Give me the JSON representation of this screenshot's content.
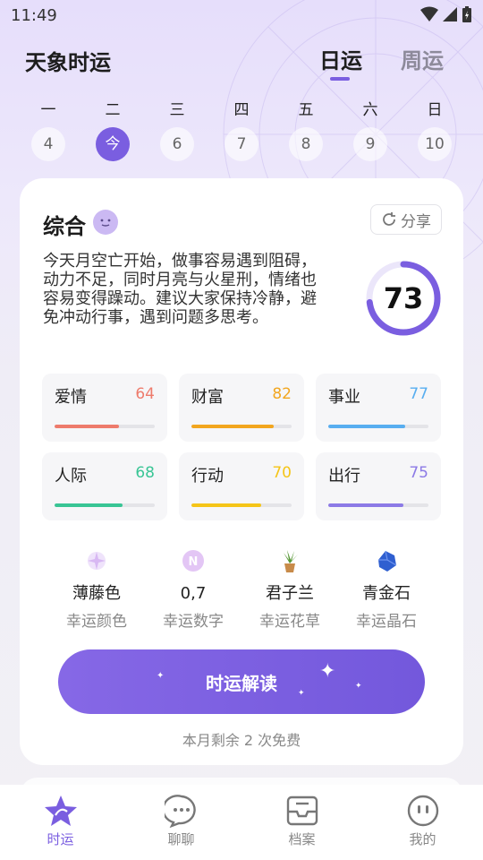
{
  "status": {
    "time": "11:49"
  },
  "header": {
    "title": "天象时运",
    "tabs": [
      {
        "label": "日运",
        "active": true
      },
      {
        "label": "周运",
        "active": false
      }
    ]
  },
  "week": {
    "days": [
      {
        "name": "一",
        "num": "4"
      },
      {
        "name": "二",
        "num": "今",
        "active": true
      },
      {
        "name": "三",
        "num": "6"
      },
      {
        "name": "四",
        "num": "7"
      },
      {
        "name": "五",
        "num": "8"
      },
      {
        "name": "六",
        "num": "9"
      },
      {
        "name": "日",
        "num": "10"
      }
    ]
  },
  "overall": {
    "title": "综合",
    "share_label": "分享",
    "summary": "今天月空亡开始，做事容易遇到阻碍，动力不足，同时月亮与火星刑，情绪也容易变得躁动。建议大家保持冷静，避免冲动行事，遇到问题多思考。",
    "score": "73",
    "score_value": 73
  },
  "metrics": [
    {
      "label": "爱情",
      "value": "64",
      "percent": 64,
      "color": "#ee7b6c"
    },
    {
      "label": "财富",
      "value": "82",
      "percent": 82,
      "color": "#f2a61f"
    },
    {
      "label": "事业",
      "value": "77",
      "percent": 77,
      "color": "#58aef0"
    },
    {
      "label": "人际",
      "value": "68",
      "percent": 68,
      "color": "#39c595"
    },
    {
      "label": "行动",
      "value": "70",
      "percent": 70,
      "color": "#f5c518"
    },
    {
      "label": "出行",
      "value": "75",
      "percent": 75,
      "color": "#8c7ae6"
    }
  ],
  "lucky": [
    {
      "value": "薄藤色",
      "label": "幸运颜色",
      "icon": "sparkle-icon"
    },
    {
      "value": "0,7",
      "label": "幸运数字",
      "icon": "number-badge-icon"
    },
    {
      "value": "君子兰",
      "label": "幸运花草",
      "icon": "plant-icon"
    },
    {
      "value": "青金石",
      "label": "幸运晶石",
      "icon": "crystal-icon"
    }
  ],
  "cta": {
    "label": "时运解读",
    "note": "本月剩余 2 次免费"
  },
  "tabbar": [
    {
      "label": "时运",
      "icon": "star-icon",
      "active": true
    },
    {
      "label": "聊聊",
      "icon": "chat-icon"
    },
    {
      "label": "档案",
      "icon": "inbox-icon"
    },
    {
      "label": "我的",
      "icon": "profile-icon"
    }
  ],
  "colors": {
    "accent": "#7a5ee0"
  }
}
